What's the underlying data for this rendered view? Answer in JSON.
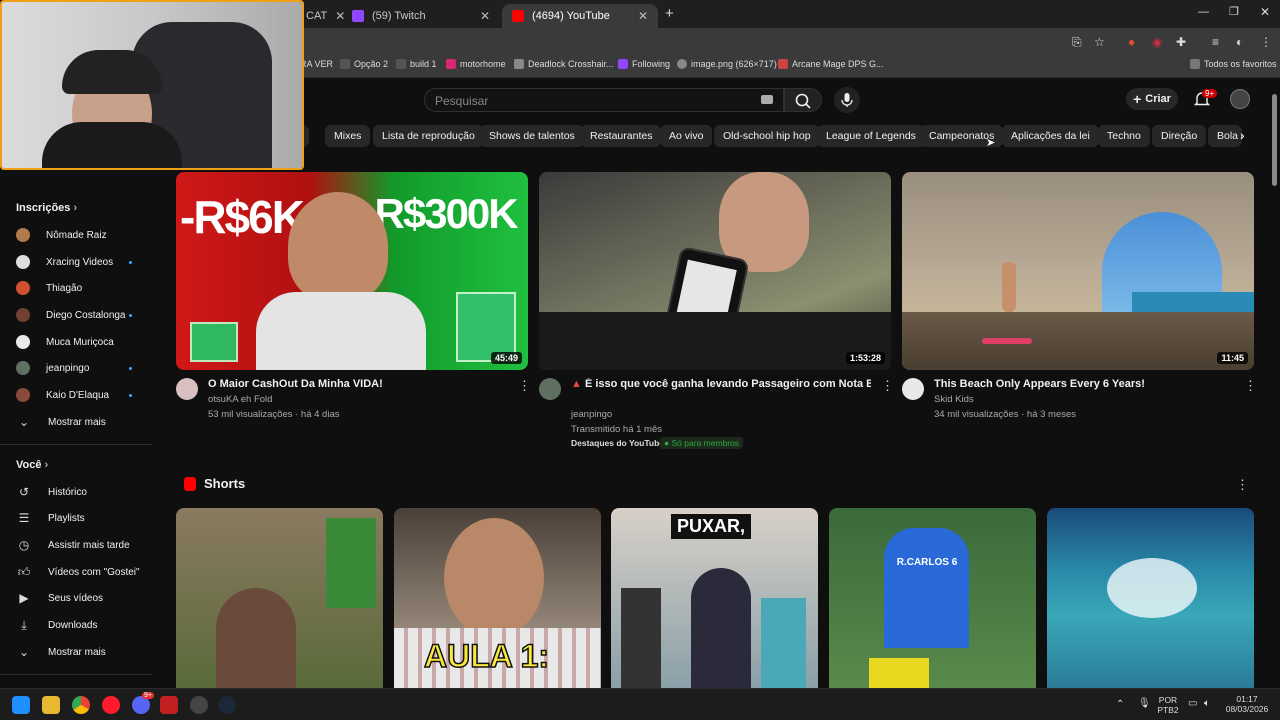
{
  "browser": {
    "tabs": [
      {
        "label": "CAT"
      },
      {
        "label": "(59) Twitch"
      },
      {
        "label": "(4694) YouTube"
      }
    ],
    "bookmarks": [
      "RA VER",
      "Opção 2",
      "build 1",
      "motorhome",
      "Deadlock Crosshair...",
      "Following",
      "image.png (626×717)",
      "Arcane Mage DPS G..."
    ],
    "all_favorites": "Todos os favoritos"
  },
  "header": {
    "search_placeholder": "Pesquisar",
    "create_label": "Criar",
    "notif_badge": "9+"
  },
  "chips": [
    "Mixes",
    "Lista de reprodução",
    "Shows de talentos",
    "Restaurantes",
    "Ao vivo",
    "Old-school hip hop",
    "League of Legends",
    "Campeonatos",
    "Aplicações da lei",
    "Techno",
    "Direção",
    "Bola d"
  ],
  "sidebar": {
    "subscriptions_title": "Inscrições",
    "subscriptions": [
      {
        "name": "Nômade Raiz",
        "dot": false,
        "color": "#b07a4a"
      },
      {
        "name": "Xracing Videos",
        "dot": true,
        "color": "#dddddd"
      },
      {
        "name": "Thiagão",
        "dot": false,
        "color": "#d05030"
      },
      {
        "name": "Diego Costalonga",
        "dot": true,
        "color": "#704030"
      },
      {
        "name": "Muca Muriçoca",
        "dot": false,
        "color": "#e8e8e8"
      },
      {
        "name": "jeanpingo",
        "dot": true,
        "color": "#607060"
      },
      {
        "name": "Kaio D'Elaqua",
        "dot": true,
        "color": "#8a4a3a"
      }
    ],
    "show_more": "Mostrar mais",
    "you_title": "Você",
    "you_items": [
      {
        "label": "Histórico",
        "icon": "history-icon"
      },
      {
        "label": "Playlists",
        "icon": "playlist-icon"
      },
      {
        "label": "Assistir mais tarde",
        "icon": "clock-icon"
      },
      {
        "label": "Vídeos com \"Gostei\"",
        "icon": "thumbs-up-icon"
      },
      {
        "label": "Seus vídeos",
        "icon": "play-icon"
      },
      {
        "label": "Downloads",
        "icon": "download-icon"
      }
    ],
    "show_more_2": "Mostrar mais"
  },
  "videos": [
    {
      "thumb_text_left": "-R$6K",
      "thumb_text_right": "+R$300K",
      "duration": "45:49",
      "title": "O Maior CashOut Da Minha VIDA!",
      "channel": "otsuKA eh Fold",
      "meta": "53 mil visualizações · há 4 dias"
    },
    {
      "duration": "1:53:28",
      "title": "É isso que você ganha levando Passageiro com Nota Baixa",
      "channel": "jeanpingo",
      "meta": "Transmitido há 1 mês",
      "extra": "Destaques do YouTube",
      "members": "Só para membros"
    },
    {
      "duration": "11:45",
      "title": "This Beach Only Appears Every 6 Years!",
      "channel": "Skid Kids",
      "meta": "34 mil visualizações · há 3 meses"
    }
  ],
  "shorts": {
    "title": "Shorts",
    "items": [
      {
        "caption": ""
      },
      {
        "caption": "AULA 1:"
      },
      {
        "caption": "PUXAR,"
      },
      {
        "caption": "R.CARLOS 6"
      },
      {
        "caption": ""
      }
    ]
  },
  "taskbar": {
    "lang_top": "POR",
    "lang_bottom": "PTB2",
    "time": "01:17",
    "date": "08/03/2026",
    "opera_badge": "9+"
  }
}
